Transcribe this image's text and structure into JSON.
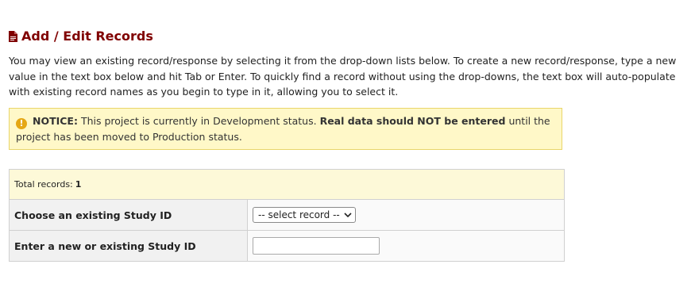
{
  "header": {
    "title": "Add / Edit Records",
    "icon": "document-icon"
  },
  "intro": {
    "text": "You may view an existing record/response by selecting it from the drop-down lists below. To create a new record/response, type a new value in the text box below and hit Tab or Enter. To quickly find a record without using the drop-downs, the text box will auto-populate with existing record names as you begin to type in it, allowing you to select it."
  },
  "notice": {
    "label": "NOTICE:",
    "text_before": " This project is currently in Development status. ",
    "emphasis": "Real data should NOT be entered",
    "text_after": " until the project has been moved to Production status.",
    "icon": "exclamation-icon",
    "bg_color": "#fff8c8"
  },
  "records": {
    "total_label": "Total records:",
    "total_count": "1",
    "choose_label": "Choose an existing Study ID",
    "select_value": "-- select record --",
    "enter_label": "Enter a new or existing Study ID",
    "enter_value": ""
  },
  "colors": {
    "title": "#800000",
    "notice_border": "#e9d56a"
  }
}
